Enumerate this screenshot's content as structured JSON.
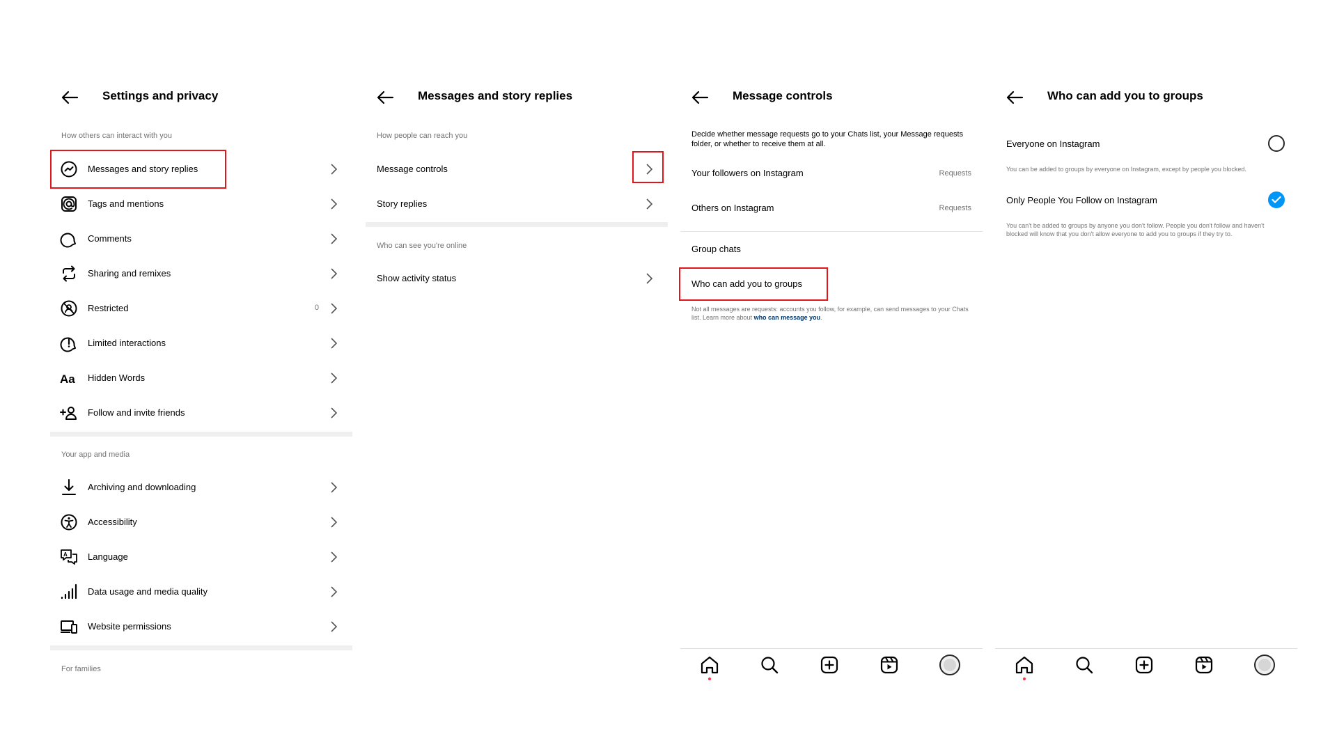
{
  "panels": {
    "settings": {
      "title": "Settings and privacy",
      "section_interact": "How others can interact with you",
      "section_app": "Your app and media",
      "section_families": "For families",
      "items": [
        {
          "label": "Messages and story replies"
        },
        {
          "label": "Tags and mentions"
        },
        {
          "label": "Comments"
        },
        {
          "label": "Sharing and remixes"
        },
        {
          "label": "Restricted",
          "count": "0"
        },
        {
          "label": "Limited interactions"
        },
        {
          "label": "Hidden Words"
        },
        {
          "label": "Follow and invite friends"
        }
      ],
      "app_items": [
        {
          "label": "Archiving and downloading"
        },
        {
          "label": "Accessibility"
        },
        {
          "label": "Language"
        },
        {
          "label": "Data usage and media quality"
        },
        {
          "label": "Website permissions"
        }
      ]
    },
    "messages": {
      "title": "Messages and story replies",
      "section_reach": "How people can reach you",
      "message_controls": "Message controls",
      "story_replies": "Story replies",
      "section_online": "Who can see you're online",
      "activity_status": "Show activity status"
    },
    "controls": {
      "title": "Message controls",
      "description": "Decide whether message requests go to your Chats list, your Message requests folder, or whether to receive them at all.",
      "followers": {
        "label": "Your followers on Instagram",
        "value": "Requests"
      },
      "others": {
        "label": "Others on Instagram",
        "value": "Requests"
      },
      "group_chats": "Group chats",
      "who_add": "Who can add you to groups",
      "note_text": "Not all messages are requests: accounts you follow, for example, can send messages to your Chats list. Learn more about",
      "note_link": "who can message you",
      "note_end": "."
    },
    "groups": {
      "title": "Who can add you to groups",
      "option_everyone": "Everyone on Instagram",
      "option_everyone_desc": "You can be added to groups by everyone on Instagram, except by people you blocked.",
      "option_following": "Only People You Follow on Instagram",
      "option_following_desc": "You can't be added to groups by anyone you don't follow. People you don't follow and haven't blocked will know that you don't allow everyone to add you to groups if they try to.",
      "selected": "Only People You Follow on Instagram"
    }
  },
  "colors": {
    "highlight": "#e0161b",
    "accent": "#0095f6",
    "link": "#00376b",
    "notification_dot": "#ff3040"
  },
  "icons": [
    "back-arrow-icon",
    "messenger-icon",
    "at-sign-icon",
    "comment-icon",
    "repost-icon",
    "restricted-icon",
    "limited-interactions-icon",
    "hidden-words-icon",
    "add-person-icon",
    "download-icon",
    "accessibility-icon",
    "language-icon",
    "signal-bars-icon",
    "website-permissions-icon",
    "chevron-right-icon",
    "home-icon",
    "search-icon",
    "create-icon",
    "reels-icon",
    "profile-avatar"
  ]
}
